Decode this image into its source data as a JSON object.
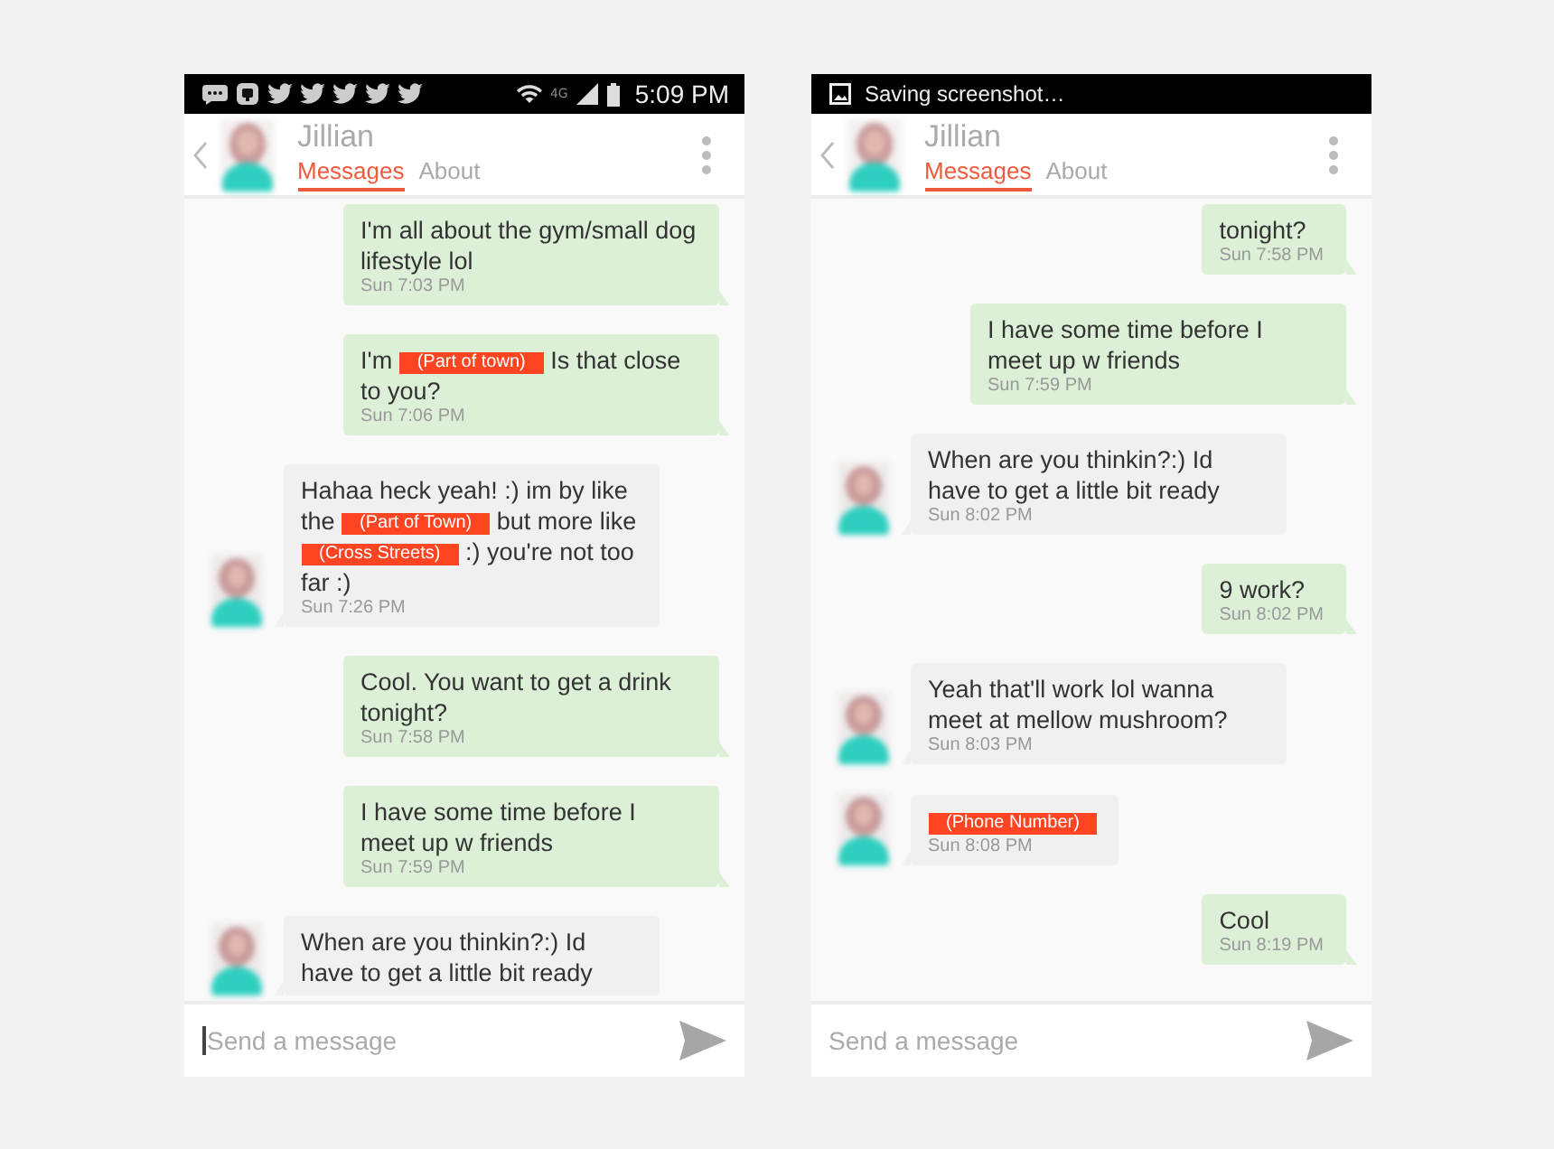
{
  "phones": [
    {
      "status_bar": {
        "kind": "icons",
        "network": "4G",
        "time": "5:09 PM"
      },
      "header": {
        "name": "Jillian",
        "tabs": [
          {
            "label": "Messages",
            "selected": true
          },
          {
            "label": "About",
            "selected": false
          }
        ]
      },
      "messages": [
        {
          "kind": "sent",
          "parts": [
            {
              "kind": "text",
              "text": "I'm all about the gym/small dog lifestyle lol"
            }
          ],
          "time": "Sun 7:03 PM"
        },
        {
          "kind": "sent",
          "parts": [
            {
              "kind": "text",
              "text": "I'm "
            },
            {
              "kind": "redacted",
              "text": "(Part of town)"
            },
            {
              "kind": "text",
              "text": " Is that close to you?"
            }
          ],
          "time": "Sun 7:06 PM"
        },
        {
          "kind": "received",
          "parts": [
            {
              "kind": "text",
              "text": "Hahaa heck yeah! :) im by like the "
            },
            {
              "kind": "redacted",
              "text": "(Part of Town)"
            },
            {
              "kind": "text",
              "text": " but more like "
            },
            {
              "kind": "redacted",
              "text": "(Cross Streets)"
            },
            {
              "kind": "text",
              "text": " :) you're not too far :)"
            }
          ],
          "time": "Sun 7:26 PM"
        },
        {
          "kind": "sent",
          "parts": [
            {
              "kind": "text",
              "text": "Cool. You want to get a drink tonight?"
            }
          ],
          "time": "Sun 7:58 PM"
        },
        {
          "kind": "sent",
          "parts": [
            {
              "kind": "text",
              "text": "I have some time before I meet up w friends"
            }
          ],
          "time": "Sun 7:59 PM"
        },
        {
          "kind": "received",
          "parts": [
            {
              "kind": "text",
              "text": "When are you thinkin?:) Id have to get a little bit ready"
            }
          ]
        }
      ],
      "composer": {
        "placeholder": "Send a message",
        "focused": true
      }
    },
    {
      "status_bar": {
        "kind": "notification",
        "text": "Saving screenshot…"
      },
      "header": {
        "name": "Jillian",
        "tabs": [
          {
            "label": "Messages",
            "selected": true
          },
          {
            "label": "About",
            "selected": false
          }
        ]
      },
      "messages": [
        {
          "kind": "sent",
          "parts": [
            {
              "kind": "text",
              "text": "tonight?"
            }
          ],
          "time": "Sun 7:58 PM"
        },
        {
          "kind": "sent",
          "parts": [
            {
              "kind": "text",
              "text": "I have some time before I meet up w friends"
            }
          ],
          "time": "Sun 7:59 PM"
        },
        {
          "kind": "received",
          "parts": [
            {
              "kind": "text",
              "text": "When are you thinkin?:) Id have to get a little bit ready"
            }
          ],
          "time": "Sun 8:02 PM"
        },
        {
          "kind": "sent",
          "parts": [
            {
              "kind": "text",
              "text": "9 work?"
            }
          ],
          "time": "Sun 8:02 PM"
        },
        {
          "kind": "received",
          "parts": [
            {
              "kind": "text",
              "text": "Yeah that'll work lol wanna meet at mellow mushroom?"
            }
          ],
          "time": "Sun 8:03 PM"
        },
        {
          "kind": "received",
          "parts": [
            {
              "kind": "redacted",
              "text": "(Phone Number)"
            }
          ],
          "time": "Sun 8:08 PM"
        },
        {
          "kind": "sent",
          "parts": [
            {
              "kind": "text",
              "text": "Cool"
            }
          ],
          "time": "Sun 8:19 PM"
        }
      ],
      "composer": {
        "placeholder": "Send a message",
        "focused": false
      }
    }
  ]
}
